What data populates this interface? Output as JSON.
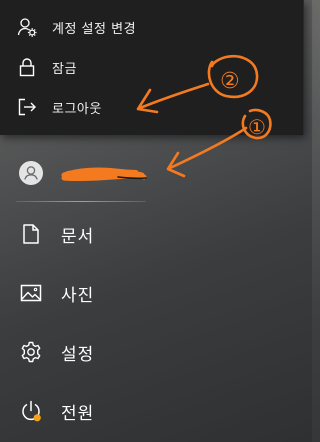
{
  "account_menu": {
    "items": [
      {
        "label": "계정 설정 변경",
        "icon": "account-settings-icon"
      },
      {
        "label": "잠금",
        "icon": "lock-icon"
      },
      {
        "label": "로그아웃",
        "icon": "sign-out-icon"
      }
    ]
  },
  "user": {
    "name": "",
    "avatar_icon": "user-avatar-icon"
  },
  "nav": {
    "items": [
      {
        "label": "문서",
        "icon": "document-icon"
      },
      {
        "label": "사진",
        "icon": "pictures-icon"
      },
      {
        "label": "설정",
        "icon": "gear-icon"
      },
      {
        "label": "전원",
        "icon": "power-icon"
      }
    ]
  },
  "annotations": {
    "marker_1": "①",
    "marker_2": "②",
    "color": "#f47a20"
  },
  "colors": {
    "flyout_bg": "#1f1f1f",
    "power_update_dot": "#f7a21b"
  }
}
